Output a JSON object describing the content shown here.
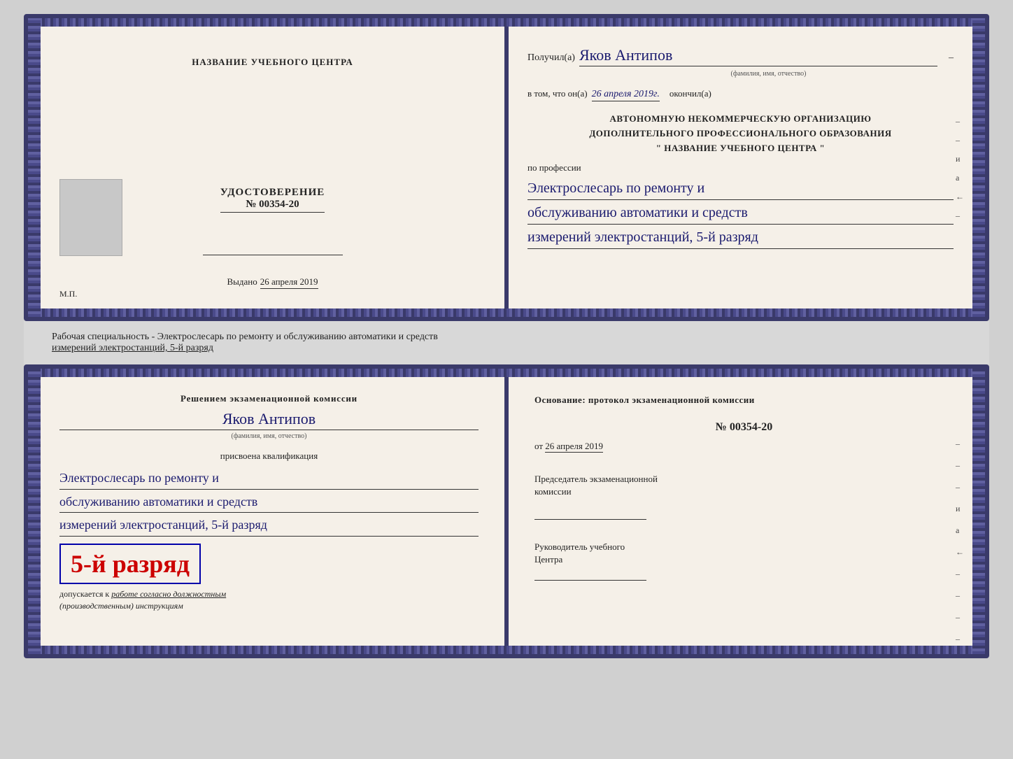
{
  "diploma": {
    "left": {
      "center_name": "НАЗВАНИЕ УЧЕБНОГО ЦЕНТРА",
      "udostoverenie_title": "УДОСТОВЕРЕНИЕ",
      "number": "№ 00354-20",
      "vydano_label": "Выдано",
      "vydano_date": "26 апреля 2019",
      "mp": "М.П."
    },
    "right": {
      "poluchil_label": "Получил(а)",
      "recipient_name": "Яков Антипов",
      "fio_hint": "(фамилия, имя, отчество)",
      "vtom_label": "в том, что он(а)",
      "date_value": "26 апреля 2019г.",
      "okoncil_label": "окончил(а)",
      "org_line1": "АВТОНОМНУЮ НЕКОММЕРЧЕСКУЮ ОРГАНИЗАЦИЮ",
      "org_line2": "ДОПОЛНИТЕЛЬНОГО ПРОФЕССИОНАЛЬНОГО ОБРАЗОВАНИЯ",
      "org_line3": "\"  НАЗВАНИЕ УЧЕБНОГО ЦЕНТРА  \"",
      "po_professii": "по профессии",
      "profession_line1": "Электрослесарь по ремонту и",
      "profession_line2": "обслуживанию автоматики и средств",
      "profession_line3": "измерений электростанций, 5-й разряд"
    }
  },
  "middle": {
    "text": "Рабочая специальность - Электрослесарь по ремонту и обслуживанию автоматики и средств",
    "text2": "измерений электростанций, 5-й разряд"
  },
  "qualification": {
    "left": {
      "resheniem_label": "Решением  экзаменационной  комиссии",
      "name": "Яков Антипов",
      "fio_hint": "(фамилия, имя, отчество)",
      "prisvoena_label": "присвоена квалификация",
      "prof_line1": "Электрослесарь по ремонту и",
      "prof_line2": "обслуживанию автоматики и средств",
      "prof_line3": "измерений электростанций, 5-й разряд",
      "razryad_label": "5-й разряд",
      "dopuskaetsya_label": "допускается к",
      "dopuskaetsya_value": "работе согласно должностным",
      "dopuskaetsya_value2": "(производственным) инструкциям"
    },
    "right": {
      "osnovanie_label": "Основание: протокол экзаменационной  комиссии",
      "number_label": "№  00354-20",
      "ot_label": "от",
      "ot_date": "26 апреля 2019",
      "chairman_line1": "Председатель экзаменационной",
      "chairman_line2": "комиссии",
      "rukovoditel_line1": "Руководитель учебного",
      "rukovoditel_line2": "Центра"
    }
  },
  "right_side_labels": {
    "u": "и",
    "a": "а",
    "back": "←",
    "dashes": [
      "–",
      "–",
      "–",
      "–",
      "–",
      "–"
    ]
  }
}
